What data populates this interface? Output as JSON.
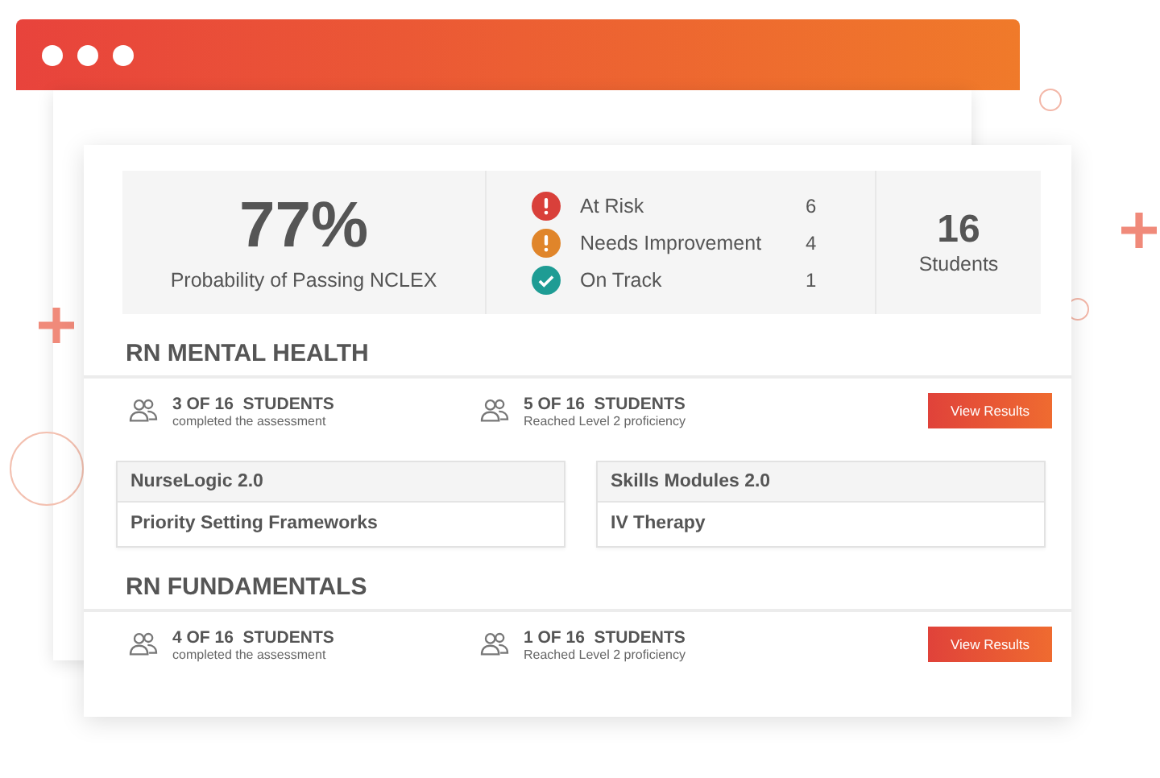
{
  "summary": {
    "probability": "77%",
    "probability_label": "Probability of Passing NCLEX",
    "statuses": [
      {
        "label": "At Risk",
        "count": "6",
        "kind": "alert",
        "color": "#d9403a"
      },
      {
        "label": "Needs Improvement",
        "count": "4",
        "kind": "alert",
        "color": "#e0852a"
      },
      {
        "label": "On Track",
        "count": "1",
        "kind": "check",
        "color": "#1e9c94"
      }
    ],
    "students_count": "16",
    "students_label": "Students"
  },
  "courses": [
    {
      "title": "RN MENTAL HEALTH",
      "stats": [
        {
          "count": "3 OF 16  STUDENTS",
          "caption": "completed the assessment"
        },
        {
          "count": "5 OF 16  STUDENTS",
          "caption": "Reached Level 2 proficiency"
        }
      ],
      "button": "View Results",
      "resources": [
        {
          "heading": "NurseLogic 2.0",
          "item": "Priority Setting Frameworks"
        },
        {
          "heading": "Skills Modules 2.0",
          "item": "IV Therapy"
        }
      ]
    },
    {
      "title": "RN FUNDAMENTALS",
      "stats": [
        {
          "count": "4 OF 16  STUDENTS",
          "caption": "completed the assessment"
        },
        {
          "count": "1 OF 16  STUDENTS",
          "caption": "Reached Level 2 proficiency"
        }
      ],
      "button": "View Results"
    }
  ]
}
